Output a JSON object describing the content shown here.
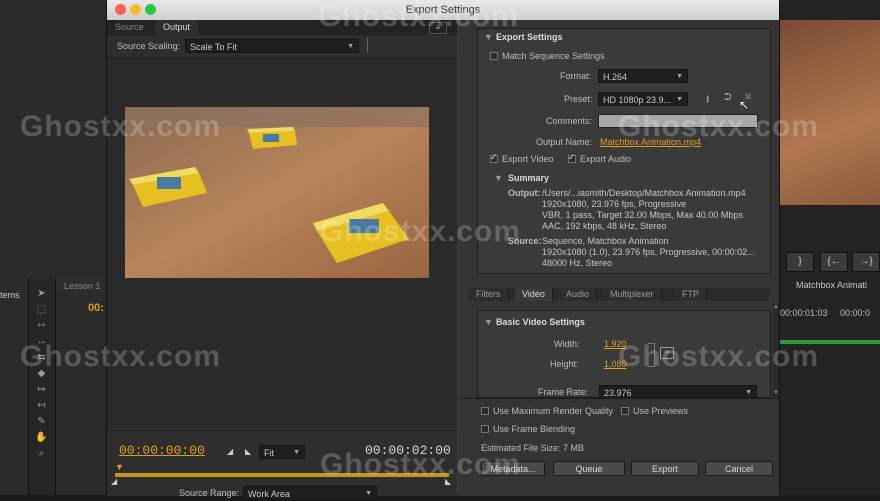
{
  "window": {
    "title": "Export Settings"
  },
  "background": {
    "tab_lesson": "Lesson 1",
    "items_label": "tems",
    "timecode": "00:",
    "right_tab": "Matchbox Animati",
    "right_tc1": "00:00:01:03",
    "right_tc2": "00:00:0",
    "btn_1": "}",
    "btn_2": "{←",
    "btn_3": "→}"
  },
  "source_tabs": [
    {
      "label": "Source"
    },
    {
      "label": "Output"
    }
  ],
  "source_scaling": {
    "label": "Source Scaling:",
    "value": "Scale To Fit"
  },
  "timeline": {
    "current_tc": "00:00:00:00",
    "duration_tc": "00:00:02:00",
    "fit": "Fit",
    "source_range_label": "Source Range:",
    "source_range_value": "Work Area"
  },
  "export_settings": {
    "header": "Export Settings",
    "match_sequence": "Match Sequence Settings",
    "format_label": "Format:",
    "format_value": "H.264",
    "preset_label": "Preset:",
    "preset_value": "HD 1080p 23.9...",
    "comments_label": "Comments:",
    "output_name_label": "Output Name:",
    "output_name_value": "Matchbox Animation.mp4",
    "export_video": "Export Video",
    "export_audio": "Export Audio"
  },
  "summary": {
    "header": "Summary",
    "output_label": "Output:",
    "output_lines": [
      "/Users/...iasmith/Desktop/Matchbox Animation.mp4",
      "1920x1080, 23.976 fps, Progressive",
      "VBR, 1 pass, Target 32.00 Mbps, Max 40.00 Mbps",
      "AAC, 192 kbps, 48 kHz, Stereo"
    ],
    "source_label": "Source:",
    "source_lines": [
      "Sequence, Matchbox Animation",
      "1920x1080 (1.0), 23.976 fps, Progressive, 00:00:02...",
      "48000 Hz, Stereo"
    ]
  },
  "settings_tabs": [
    {
      "label": "Filters"
    },
    {
      "label": "Video"
    },
    {
      "label": "Audio"
    },
    {
      "label": "Multiplexer"
    },
    {
      "label": "FTP"
    }
  ],
  "basic_video": {
    "header": "Basic Video Settings",
    "width_label": "Width:",
    "width_value": "1,920",
    "height_label": "Height:",
    "height_value": "1,080",
    "frame_rate_label": "Frame Rate:",
    "frame_rate_value": "23.976"
  },
  "options": {
    "max_render": "Use Maximum Render Quality",
    "use_previews": "Use Previews",
    "frame_blending": "Use Frame Blending",
    "file_size_label": "Estimated File Size:",
    "file_size_value": "7 MB"
  },
  "buttons": {
    "metadata": "Metadata...",
    "queue": "Queue",
    "export": "Export",
    "cancel": "Cancel"
  },
  "watermark": "Ghostxx.com",
  "colors": {
    "accent": "#e0a020",
    "panel": "#3a3a3a",
    "dark": "#2e2e2e"
  }
}
